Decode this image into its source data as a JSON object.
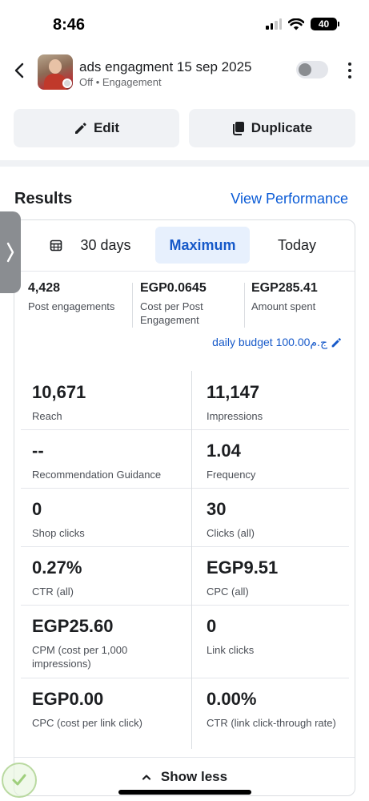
{
  "status_bar": {
    "time": "8:46",
    "battery": "40"
  },
  "header": {
    "title": "ads engagment 15 sep 2025",
    "subtitle": "Off • Engagement"
  },
  "actions": {
    "edit_label": "Edit",
    "duplicate_label": "Duplicate"
  },
  "results": {
    "title": "Results",
    "view_performance": "View Performance",
    "tabs": {
      "days": "30 days",
      "maximum": "Maximum",
      "today": "Today"
    },
    "summary": [
      {
        "value": "4,428",
        "label": "Post engagements"
      },
      {
        "value": "EGP0.0645",
        "label": "Cost per Post Engagement"
      },
      {
        "value": "EGP285.41",
        "label": "Amount spent"
      }
    ],
    "budget": "daily budget 100.00ج.م",
    "metrics_left": [
      {
        "value": "10,671",
        "label": "Reach"
      },
      {
        "value": "--",
        "label": "Recommendation Guidance"
      },
      {
        "value": "0",
        "label": "Shop clicks"
      },
      {
        "value": "0.27%",
        "label": "CTR (all)"
      },
      {
        "value": "EGP25.60",
        "label": "CPM (cost per 1,000 impressions)"
      },
      {
        "value": "EGP0.00",
        "label": "CPC (cost per link click)"
      }
    ],
    "metrics_right": [
      {
        "value": "11,147",
        "label": "Impressions"
      },
      {
        "value": "1.04",
        "label": "Frequency"
      },
      {
        "value": "30",
        "label": "Clicks (all)"
      },
      {
        "value": "EGP9.51",
        "label": "CPC (all)"
      },
      {
        "value": "0",
        "label": "Link clicks"
      },
      {
        "value": "0.00%",
        "label": "CTR (link click-through rate)"
      }
    ],
    "show_less": "Show less"
  },
  "colors": {
    "accent_blue": "#1659c9",
    "link_blue": "#0a5bd6",
    "tab_active_bg": "#e7f0fd",
    "button_bg": "#f0f2f5"
  }
}
